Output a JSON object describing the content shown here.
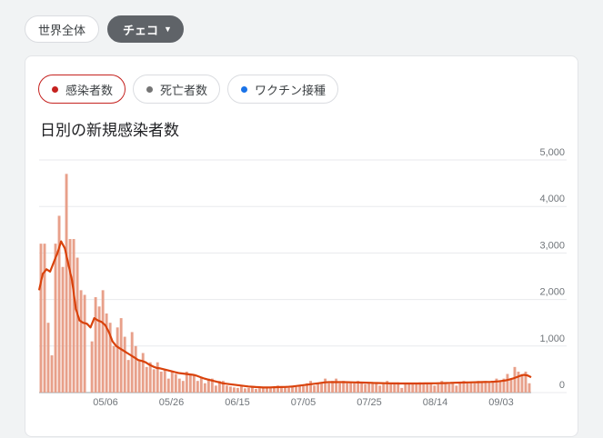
{
  "region_chips": [
    {
      "label": "世界全体"
    },
    {
      "label": "チェコ"
    }
  ],
  "metric_chips": [
    {
      "label": "感染者数",
      "color": "#c5221f",
      "active": true
    },
    {
      "label": "死亡者数",
      "color": "#757575",
      "active": false
    },
    {
      "label": "ワクチン接種",
      "color": "#1a73e8",
      "active": false
    }
  ],
  "chart_title": "日別の新規感染者数",
  "colors": {
    "bar": "#e8a08a",
    "line": "#d9420b",
    "grid": "#e8eaed"
  },
  "chart_data": {
    "type": "bar",
    "title": "日別の新規感染者数",
    "ylim": [
      0,
      5000
    ],
    "y_ticks": [
      "5,000",
      "4,000",
      "3,000",
      "2,000",
      "1,000",
      "0"
    ],
    "x_ticks": [
      "05/06",
      "05/26",
      "06/15",
      "07/05",
      "07/25",
      "08/14",
      "09/03"
    ],
    "grid": true,
    "values": [
      3200,
      3200,
      1500,
      800,
      3200,
      3800,
      2700,
      4700,
      3300,
      3300,
      2900,
      2200,
      2100,
      0,
      1100,
      2050,
      1850,
      2200,
      1700,
      1500,
      1000,
      1400,
      1600,
      1200,
      700,
      1300,
      1000,
      700,
      850,
      550,
      650,
      500,
      650,
      450,
      500,
      300,
      450,
      400,
      300,
      250,
      450,
      400,
      400,
      250,
      330,
      200,
      300,
      300,
      150,
      250,
      250,
      150,
      130,
      110,
      100,
      130,
      90,
      100,
      120,
      80,
      90,
      110,
      100,
      120,
      100,
      150,
      130,
      110,
      100,
      150,
      120,
      160,
      140,
      200,
      250,
      150,
      200,
      200,
      300,
      200,
      250,
      300,
      200,
      250,
      200,
      220,
      200,
      250,
      200,
      180,
      200,
      220,
      200,
      150,
      200,
      250,
      200,
      200,
      220,
      100,
      200,
      200,
      180,
      200,
      220,
      200,
      180,
      200,
      150,
      180,
      250,
      200,
      180,
      200,
      150,
      200,
      250,
      200,
      220,
      200,
      250,
      220,
      250,
      230,
      250,
      300,
      250,
      300,
      400,
      300,
      550,
      450,
      400,
      450,
      200
    ],
    "average": [
      2200,
      2550,
      2650,
      2600,
      2800,
      3000,
      3250,
      3100,
      2750,
      2400,
      1800,
      1550,
      1500,
      1480,
      1400,
      1600,
      1550,
      1520,
      1450,
      1300,
      1100,
      1000,
      950,
      900,
      850,
      800,
      750,
      700,
      680,
      650,
      600,
      560,
      530,
      520,
      500,
      480,
      460,
      440,
      420,
      410,
      400,
      390,
      380,
      360,
      330,
      300,
      280,
      260,
      240,
      220,
      200,
      190,
      180,
      170,
      160,
      150,
      140,
      130,
      125,
      120,
      115,
      110,
      110,
      112,
      115,
      118,
      120,
      122,
      125,
      130,
      140,
      150,
      160,
      170,
      180,
      190,
      200,
      210,
      220,
      225,
      225,
      225,
      225,
      225,
      222,
      220,
      218,
      216,
      214,
      212,
      210,
      208,
      206,
      204,
      202,
      200,
      198,
      197,
      196,
      195,
      195,
      195,
      195,
      195,
      196,
      197,
      198,
      199,
      200,
      202,
      204,
      206,
      208,
      210,
      212,
      214,
      216,
      218,
      220,
      222,
      224,
      226,
      228,
      230,
      235,
      240,
      250,
      260,
      280,
      300,
      330,
      360,
      380,
      370,
      330
    ]
  }
}
